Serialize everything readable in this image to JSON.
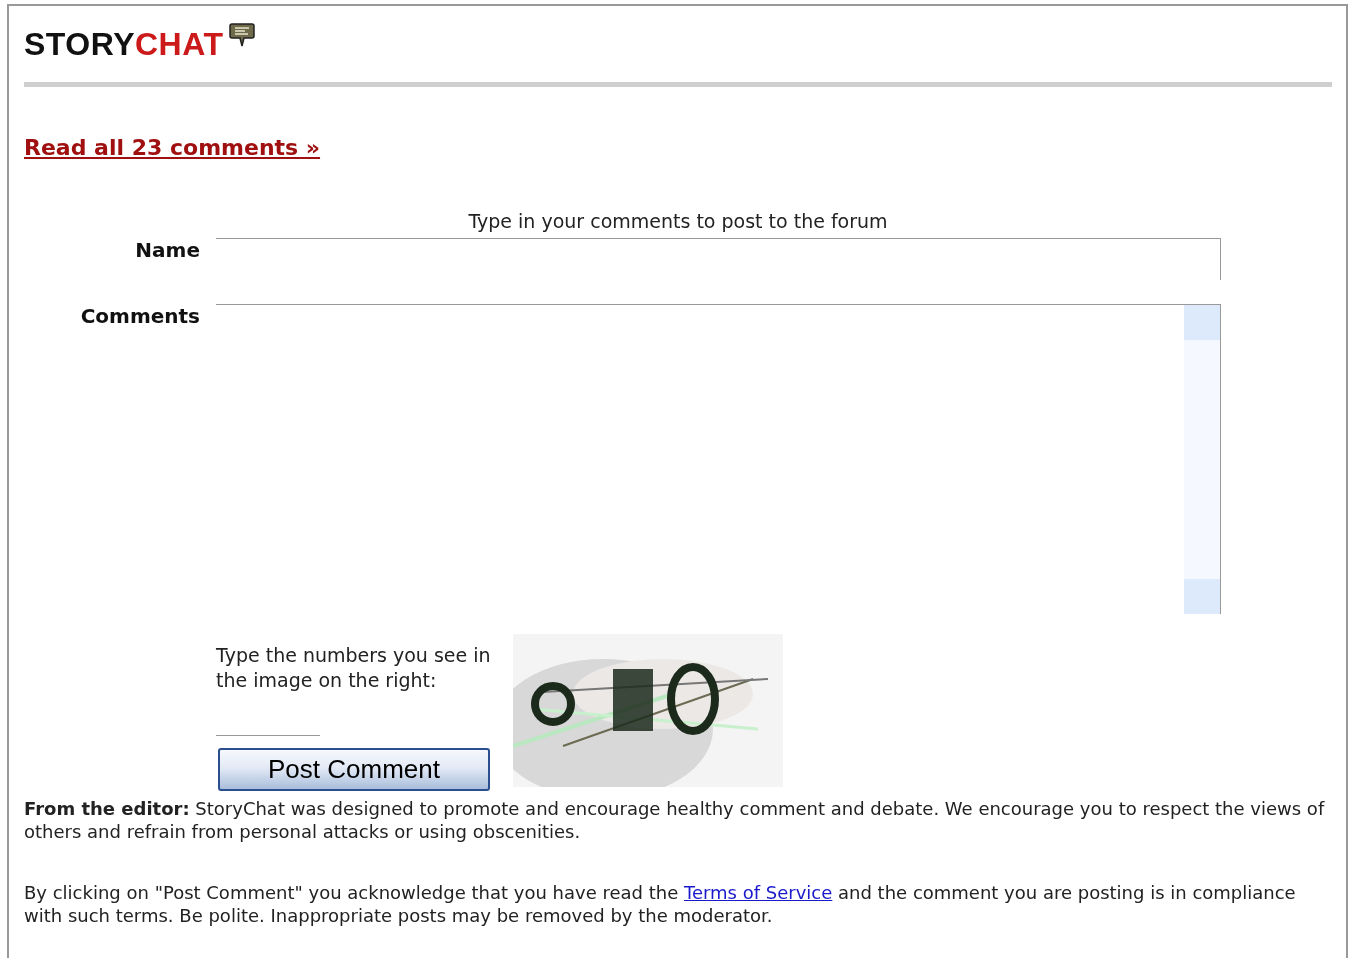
{
  "logo": {
    "parts": [
      {
        "text": "STORY",
        "color": "#111111"
      },
      {
        "text": "CHAT",
        "color": "#cc1a1a"
      }
    ]
  },
  "read_all_link": "Read all 23 comments »",
  "form": {
    "intro": "Type in your comments to post to the forum",
    "fields": [
      {
        "label": "Name",
        "kind": "line"
      },
      {
        "label": "Comments",
        "kind": "area"
      }
    ],
    "captcha_prompt": "Type the numbers you see in the image on the right:",
    "submit": "Post Comment"
  },
  "editor_note": "**From the editor:** StoryChat was designed to promote and encourage healthy comment and debate. We encourage you to respect the views of others and refrain from personal attacks or using obscenities.",
  "terms": {
    "before": "By clicking on \"Post Comment\" you acknowledge that you have read the ",
    "link": "Terms of Service",
    "after": " and the comment you are posting is in compliance with such terms. Be polite. Inappropriate posts may be removed by the moderator."
  }
}
